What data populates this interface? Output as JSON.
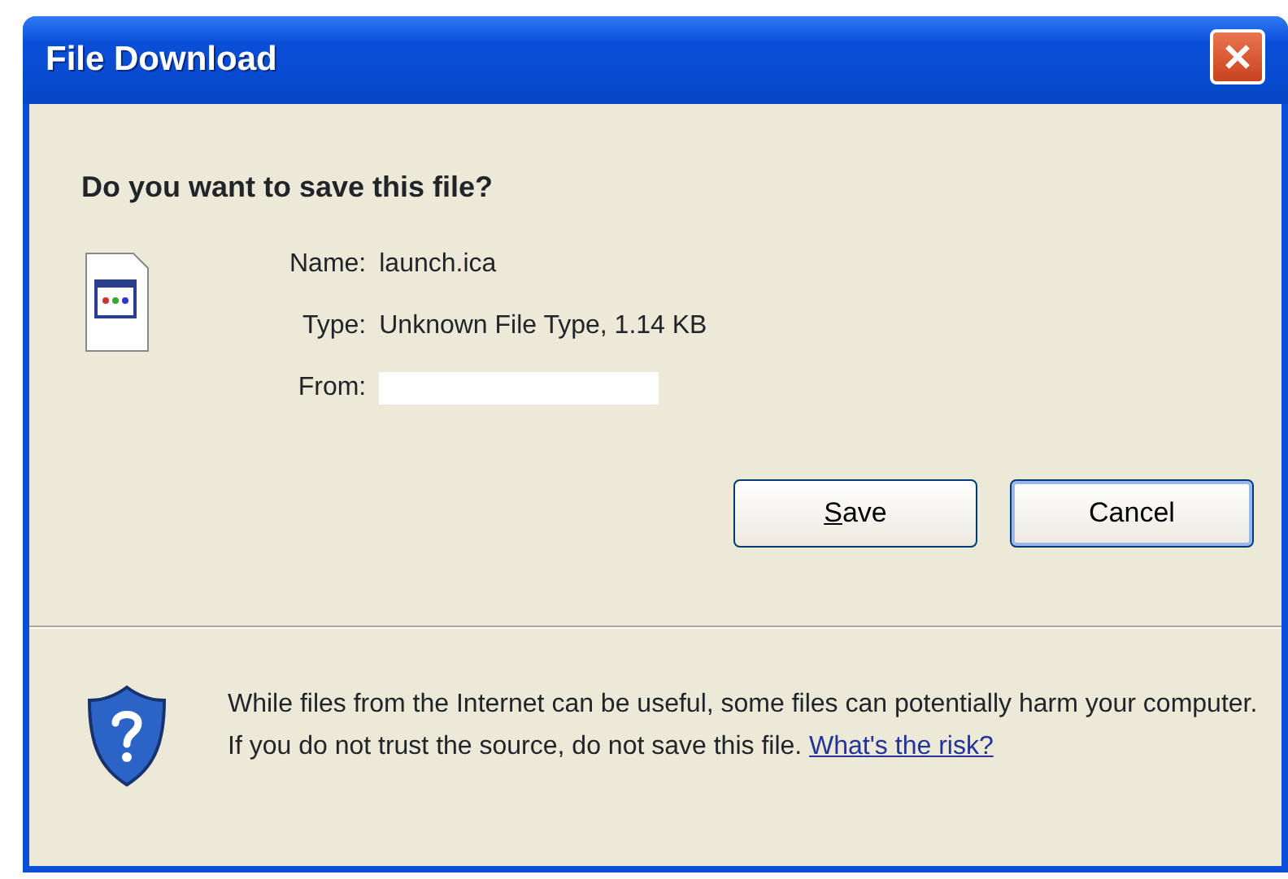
{
  "window": {
    "title": "File Download"
  },
  "question": "Do you want to save this file?",
  "fields": [
    {
      "label": "Name:",
      "value": "launch.ica",
      "kind": "text"
    },
    {
      "label": "Type:",
      "value": "Unknown File Type, 1.14 KB",
      "kind": "text"
    },
    {
      "label": "From:",
      "kind": "blank"
    }
  ],
  "buttons": [
    {
      "label": "Save",
      "underline_first": true,
      "default": false
    },
    {
      "label": "Cancel",
      "underline_first": false,
      "default": true
    }
  ],
  "warning": {
    "text": "While files from the Internet can be useful, some files can potentially harm your computer. If you do not trust the source, do not save this file.",
    "link": "What's the risk?"
  }
}
